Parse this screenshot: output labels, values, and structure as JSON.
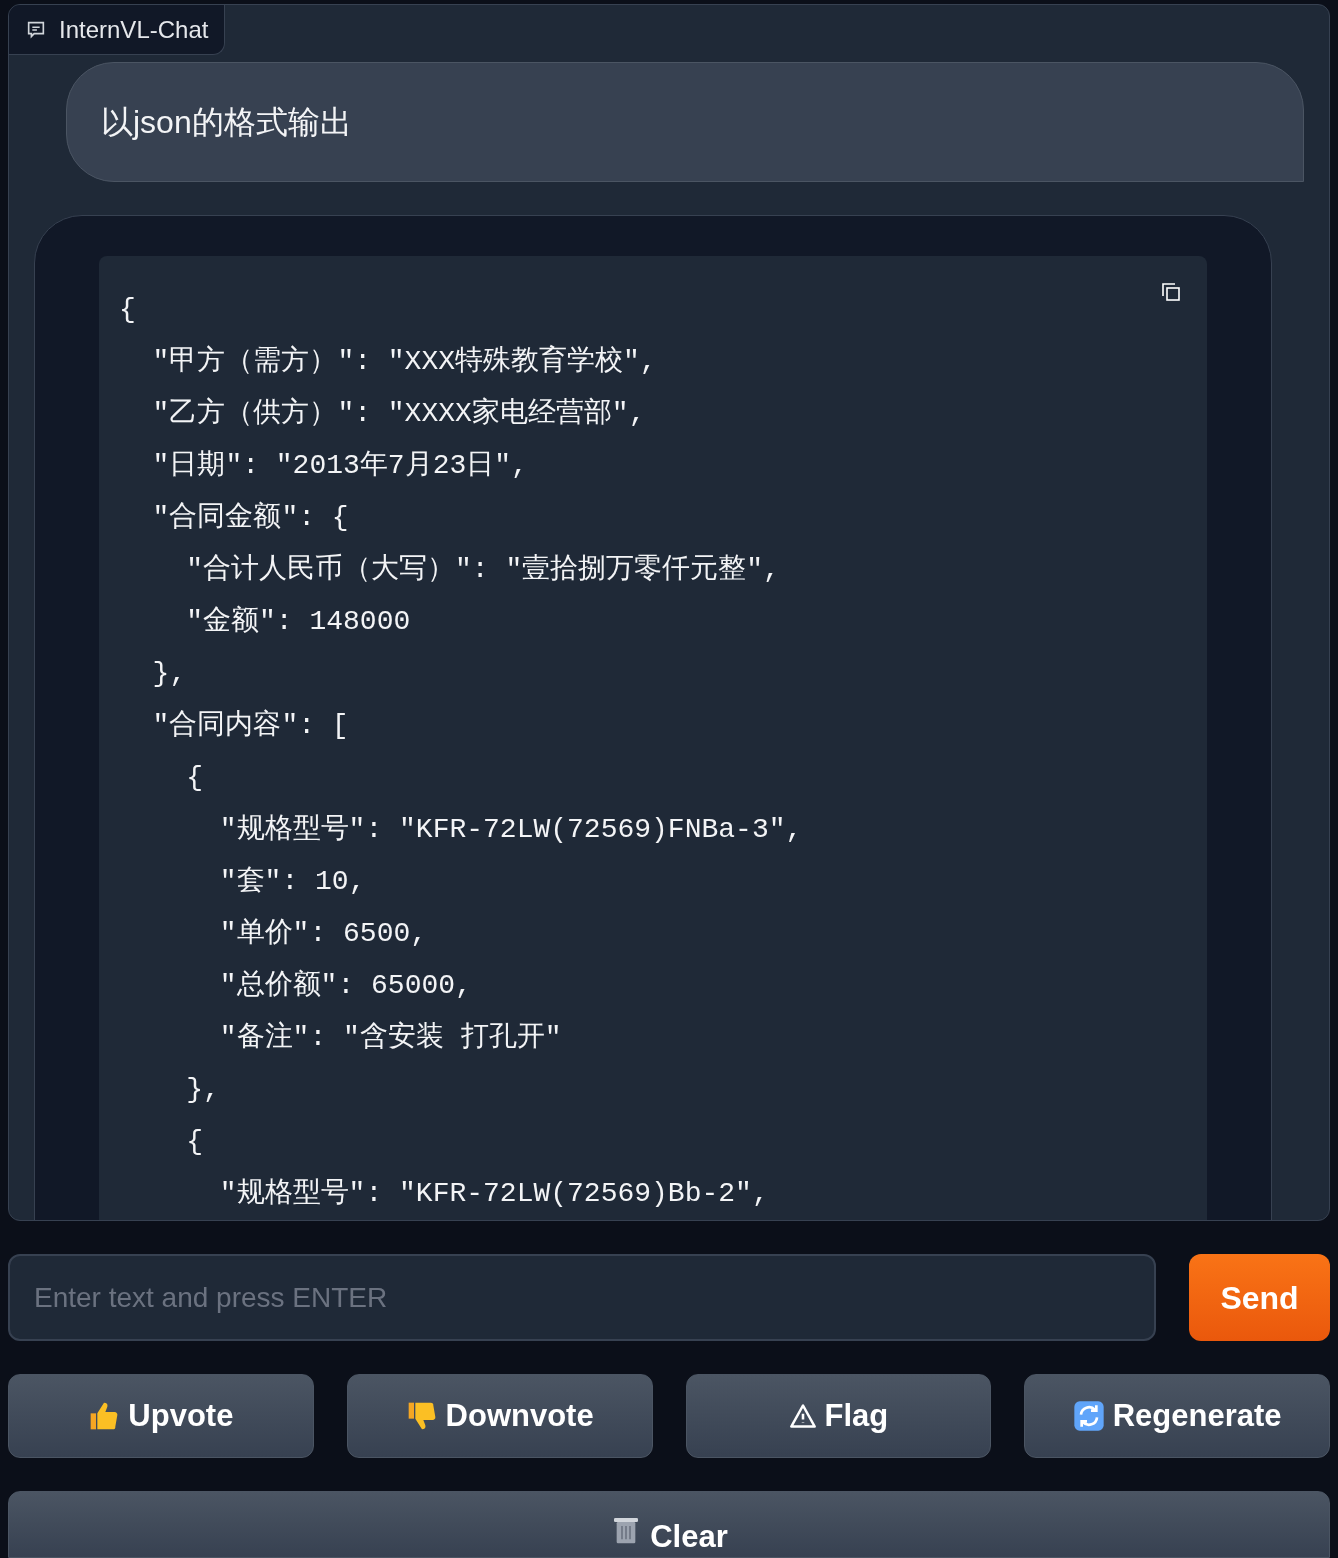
{
  "chatbot": {
    "label": "InternVL-Chat",
    "messages": [
      {
        "kind": "user",
        "text": "以json的格式输出"
      },
      {
        "kind": "bot",
        "code": [
          "{",
          "  \"甲方（需方）\": \"XXX特殊教育学校\",",
          "  \"乙方（供方）\": \"XXXX家电经营部\",",
          "  \"日期\": \"2013年7月23日\",",
          "  \"合同金额\": {",
          "    \"合计人民币（大写）\": \"壹拾捌万零仟元整\",",
          "    \"金额\": 148000",
          "  },",
          "  \"合同内容\": [",
          "    {",
          "      \"规格型号\": \"KFR-72LW(72569)FNBa-3\",",
          "      \"套\": 10,",
          "      \"单价\": 6500,",
          "      \"总价额\": 65000,",
          "      \"备注\": \"含安装 打孔开\"",
          "    },",
          "    {",
          "      \"规格型号\": \"KFR-72LW(72569)Bb-2\","
        ]
      }
    ]
  },
  "input": {
    "placeholder": "Enter text and press ENTER"
  },
  "send_button": "Send",
  "actions": [
    {
      "kind": "upvote",
      "label": "Upvote"
    },
    {
      "kind": "downvote",
      "label": "Downvote"
    },
    {
      "kind": "flag",
      "label": "Flag"
    },
    {
      "kind": "regenerate",
      "label": "Regenerate"
    }
  ],
  "clear_button": "Clear"
}
